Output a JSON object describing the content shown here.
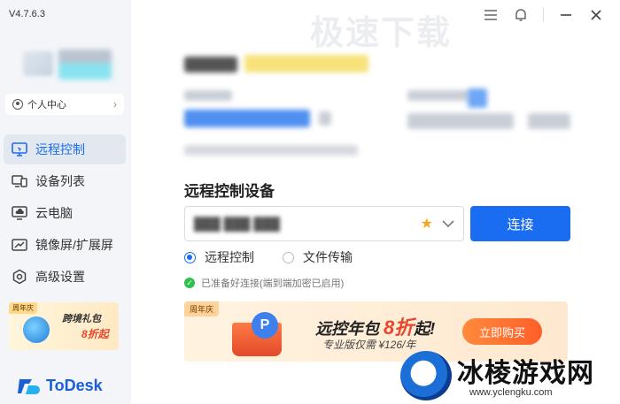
{
  "app": {
    "version": "V4.7.6.3",
    "brand": "ToDesk"
  },
  "profile": {
    "label": "个人中心"
  },
  "sidebar": {
    "items": [
      {
        "label": "远程控制",
        "icon": "monitor-icon",
        "active": true
      },
      {
        "label": "设备列表",
        "icon": "devices-icon",
        "active": false
      },
      {
        "label": "云电脑",
        "icon": "cloud-pc-icon",
        "active": false
      },
      {
        "label": "镜像屏/扩展屏",
        "icon": "mirror-screen-icon",
        "active": false
      },
      {
        "label": "高级设置",
        "icon": "settings-icon",
        "active": false
      }
    ],
    "promo": {
      "tag": "周年庆",
      "title": "跨境礼包",
      "discount": "8折起"
    }
  },
  "main": {
    "section_title": "远程控制设备",
    "device_input": {
      "value": "███ ███ ███"
    },
    "connect_label": "连接",
    "radio": {
      "options": [
        "远程控制",
        "文件传输"
      ],
      "selected": "远程控制"
    },
    "status_text": "已准备好连接(端到端加密已启用)",
    "banner": {
      "tag": "周年庆",
      "title_prefix": "远控年包",
      "title_highlight": "8折",
      "title_suffix": "起!",
      "subtitle": "专业版仅需 ¥126/年",
      "buy_label": "立即购买"
    }
  },
  "watermark": {
    "top_text": "极速下载",
    "text": "冰棱游戏网",
    "url": "www.yclengku.com"
  },
  "colors": {
    "accent": "#1a6cf0",
    "success": "#2ec04f",
    "promo": "#e8472c"
  }
}
